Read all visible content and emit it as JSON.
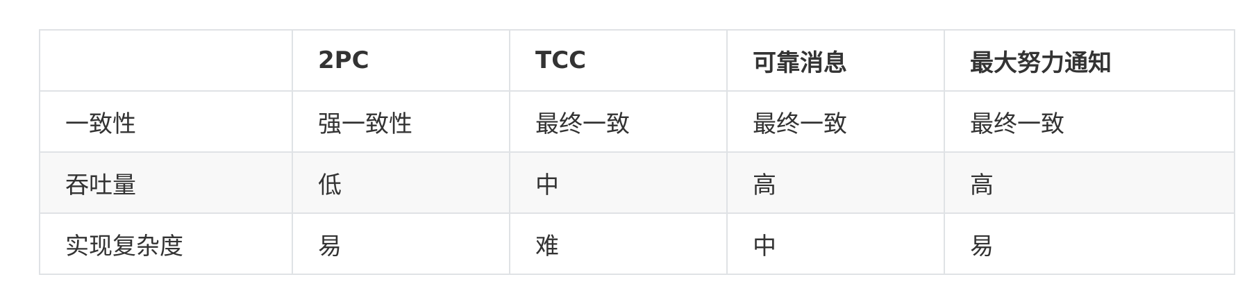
{
  "table": {
    "headers": [
      "",
      "2PC",
      "TCC",
      "可靠消息",
      "最大努力通知"
    ],
    "rows": [
      [
        "一致性",
        "强一致性",
        "最终一致",
        "最终一致",
        "最终一致"
      ],
      [
        "吞吐量",
        "低",
        "中",
        "高",
        "高"
      ],
      [
        "实现复杂度",
        "易",
        "难",
        "中",
        "易"
      ]
    ]
  }
}
